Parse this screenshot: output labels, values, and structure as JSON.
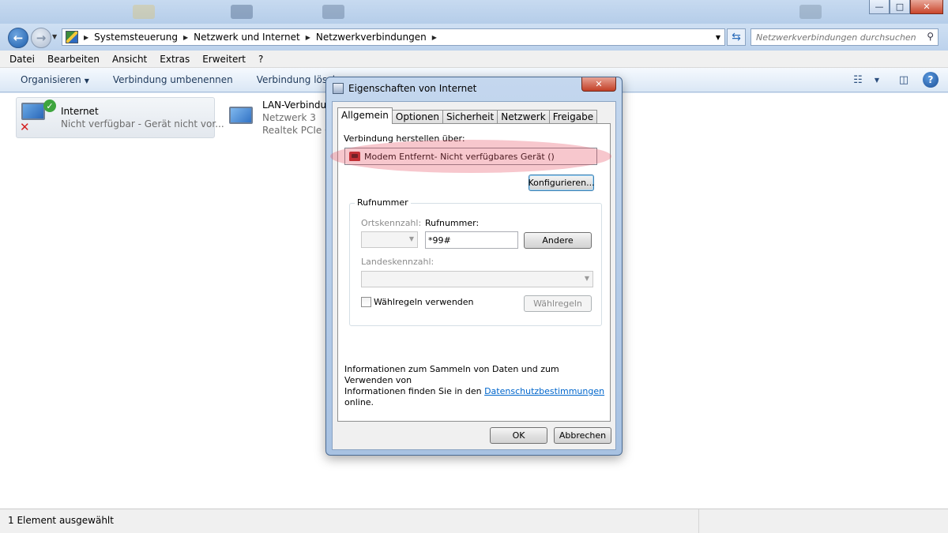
{
  "explorer": {
    "window_buttons": {
      "minimize": "—",
      "maximize": "□",
      "close": "✕"
    },
    "address": {
      "crumbs": [
        "Systemsteuerung",
        "Netzwerk und Internet",
        "Netzwerkverbindungen"
      ]
    },
    "search": {
      "placeholder": "Netzwerkverbindungen durchsuchen"
    },
    "menu": [
      "Datei",
      "Bearbeiten",
      "Ansicht",
      "Extras",
      "Erweitert",
      "?"
    ],
    "commands": {
      "organize": "Organisieren",
      "rename": "Verbindung umbenennen",
      "delete": "Verbindung löschen"
    },
    "connections": [
      {
        "name": "Internet",
        "status": "Nicht verfügbar - Gerät nicht vor..."
      },
      {
        "name": "LAN-Verbindun",
        "network": "Netzwerk  3",
        "adapter": "Realtek PCIe GI"
      }
    ],
    "status_text": "1 Element ausgewählt"
  },
  "dialog": {
    "title": "Eigenschaften von Internet",
    "close": "✕",
    "tabs": [
      "Allgemein",
      "Optionen",
      "Sicherheit",
      "Netzwerk",
      "Freigabe"
    ],
    "connect_via_label": "Verbindung herstellen über:",
    "device": "Modem Entfernt- Nicht verfügbares Gerät ()",
    "configure_button": "Konfigurieren...",
    "phone_group": {
      "title": "Rufnummer",
      "area_code_label": "Ortskennzahl:",
      "number_label": "Rufnummer:",
      "number_value": "*99#",
      "alternates_button": "Andere",
      "country_code_label": "Landeskennzahl:",
      "dialing_rules_label": "Wählregeln verwenden",
      "dialing_rules_button": "Wählregeln"
    },
    "info_text_1": "Informationen zum Sammeln von Daten und zum Verwenden von",
    "info_text_2": "Informationen finden Sie in den",
    "info_link": "Datenschutzbestimmungen",
    "info_text_3": "online.",
    "ok_button": "OK",
    "cancel_button": "Abbrechen"
  }
}
